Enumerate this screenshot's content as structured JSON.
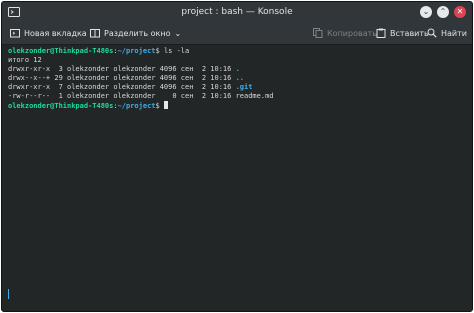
{
  "window": {
    "title": "project : bash — Konsole",
    "buttons": [
      "minimize-button",
      "maximize-button",
      "close-button"
    ]
  },
  "toolbar": {
    "new_tab": "Новая вкладка",
    "split": "Разделить окно",
    "copy": "Копировать",
    "paste": "Вставить",
    "find": "Найти"
  },
  "terminal": {
    "prompt_user": "olekzonder@Thinkpad-T480s",
    "prompt_sep": ":",
    "prompt_path": "~/project",
    "prompt_end": "$ ",
    "command": "ls -la",
    "total": "итого 12",
    "entries": [
      {
        "text": "drwxr-xr-x  3 olekzonder olekzonder 4096 сен  2 10:16 ",
        "name": "."
      },
      {
        "text": "drwx--x--+ 29 olekzonder olekzonder 4096 сен  2 10:16 ",
        "name": ".."
      },
      {
        "text": "drwxr-xr-x  7 olekzonder olekzonder 4096 сен  2 10:16 ",
        "name": ".git"
      },
      {
        "text": "-rw-r--r--  1 olekzonder olekzonder    0 сен  2 10:16 ",
        "name": "readme.md"
      }
    ]
  },
  "colors": {
    "background": "#232627",
    "prompt": "#1cdc9a",
    "path": "#3daee9",
    "close": "#da4453"
  }
}
